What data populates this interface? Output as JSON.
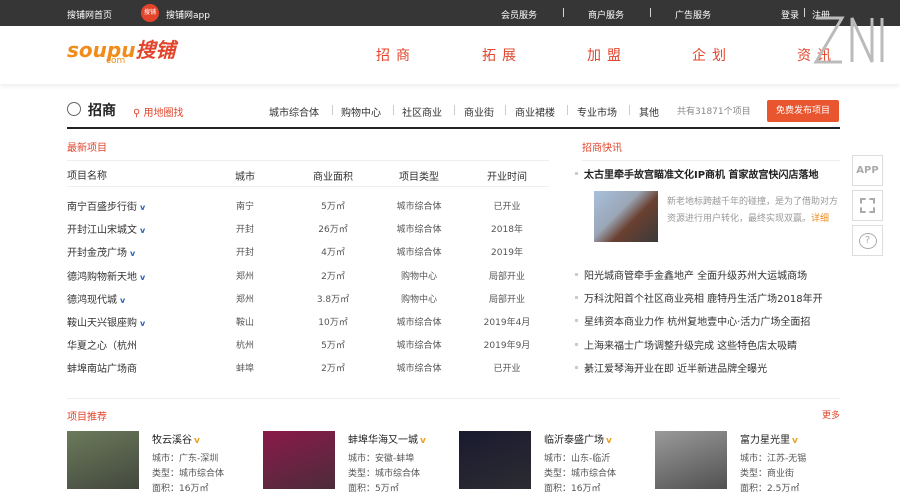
{
  "topbar": {
    "home": "搜铺网首页",
    "app_badge": "搜铺",
    "app": "搜铺网app",
    "member": "会员服务",
    "merchant": "商户服务",
    "ads": "广告服务",
    "login": "登录",
    "register": "注册",
    "sep": "|"
  },
  "logo": {
    "text1": "soupu",
    "text2": "搜铺",
    "sub": "com"
  },
  "nav": [
    "招商",
    "拓展",
    "加盟",
    "企划",
    "资讯"
  ],
  "section": {
    "title": "招商",
    "map_link": "用地圈找",
    "categories": [
      "城市综合体",
      "购物中心",
      "社区商业",
      "商业街",
      "商业裙楼",
      "专业市场",
      "其他"
    ],
    "count": "共有31871个项目",
    "publish": "免费发布项目"
  },
  "latest": {
    "title": "最新项目",
    "headers": [
      "项目名称",
      "城市",
      "商业面积",
      "项目类型",
      "开业时间"
    ],
    "rows": [
      {
        "name": "南宁百盛步行街",
        "v": true,
        "city": "南宁",
        "area": "5万㎡",
        "type": "城市综合体",
        "time": "已开业"
      },
      {
        "name": "开封江山宋城文",
        "v": true,
        "city": "开封",
        "area": "26万㎡",
        "type": "城市综合体",
        "time": "2018年"
      },
      {
        "name": "开封金茂广场",
        "v": true,
        "city": "开封",
        "area": "4万㎡",
        "type": "城市综合体",
        "time": "2019年"
      },
      {
        "name": "德鸿购物新天地",
        "v": true,
        "city": "郑州",
        "area": "2万㎡",
        "type": "购物中心",
        "time": "局部开业"
      },
      {
        "name": "德鸿现代城",
        "v": true,
        "city": "郑州",
        "area": "3.8万㎡",
        "type": "购物中心",
        "time": "局部开业"
      },
      {
        "name": "鞍山天兴银座购",
        "v": true,
        "city": "鞍山",
        "area": "10万㎡",
        "type": "城市综合体",
        "time": "2019年4月"
      },
      {
        "name": "华夏之心（杭州",
        "v": false,
        "city": "杭州",
        "area": "5万㎡",
        "type": "城市综合体",
        "time": "2019年9月"
      },
      {
        "name": "蚌埠南站广场商",
        "v": false,
        "city": "蚌埠",
        "area": "2万㎡",
        "type": "城市综合体",
        "time": "已开业"
      }
    ],
    "v_mark": "v"
  },
  "news": {
    "title": "招商快讯",
    "headline": "太古里牵手故宫瞄准文化IP商机 首家故宫快闪店落地",
    "desc1": "新老地标跨越千年的碰撞，是为了借助对方",
    "desc2": "资源进行用户转化，最终实现双赢。",
    "detail": "详细",
    "items": [
      "阳光城商管牵手金鑫地产 全面升级苏州大运城商场",
      "万科沈阳首个社区商业亮相 鹿特丹生活广场2018年开",
      "星纬资本商业力作 杭州复地壹中心·活力广场全面招",
      "上海来福士广场调整升级完成 这些特色店太吸睛",
      "綦江爱琴海开业在即 近半新进品牌全曝光"
    ]
  },
  "side": {
    "app": "APP",
    "help": "?"
  },
  "recommend": {
    "title": "项目推荐",
    "more": "更多",
    "v_mark": "v",
    "cards": [
      {
        "name": "牧云溪谷",
        "city": "城市：广东-深圳",
        "type": "类型：城市综合体",
        "area": "面积：16万㎡",
        "color": "#6b7a5a"
      },
      {
        "name": "蚌埠华海又一城",
        "city": "城市：安徽-蚌埠",
        "type": "类型：城市综合体",
        "area": "面积：5万㎡",
        "color": "#8a1a4a"
      },
      {
        "name": "临沂泰盛广场",
        "city": "城市：山东-临沂",
        "type": "类型：城市综合体",
        "area": "面积：16万㎡",
        "color": "#1a1a30"
      },
      {
        "name": "富力星光里",
        "city": "城市：江苏-无锡",
        "type": "类型：商业街",
        "area": "面积：2.5万㎡",
        "color": "#9a9a9a"
      }
    ]
  }
}
